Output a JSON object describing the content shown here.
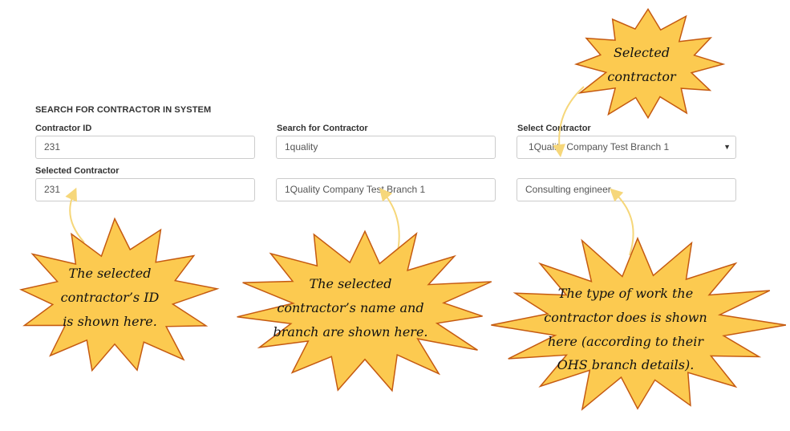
{
  "form": {
    "section_title": "SEARCH FOR CONTRACTOR IN SYSTEM",
    "contractor_id": {
      "label": "Contractor ID",
      "value": "231"
    },
    "search_contractor": {
      "label": "Search for Contractor",
      "value": "1quality"
    },
    "select_contractor": {
      "label": "Select Contractor",
      "value": "1Quality Company Test Branch 1"
    },
    "selected_contractor": {
      "label": "Selected Contractor",
      "id_value": "231",
      "name_value": "1Quality Company Test Branch 1",
      "work_type_value": "Consulting engineer"
    }
  },
  "callouts": {
    "selected": [
      "Selected",
      "contractor"
    ],
    "id": [
      "The selected",
      "contractor’s ID",
      "is shown here."
    ],
    "name": [
      "The selected",
      "contractor’s name and",
      "branch are shown here."
    ],
    "work": [
      "The type of work the",
      "contractor does is shown",
      "here (according to their",
      "OHS branch details)."
    ]
  },
  "colors": {
    "callout_fill": "#fcca50",
    "callout_stroke": "#c55a11",
    "arrow": "#f6d77a"
  }
}
